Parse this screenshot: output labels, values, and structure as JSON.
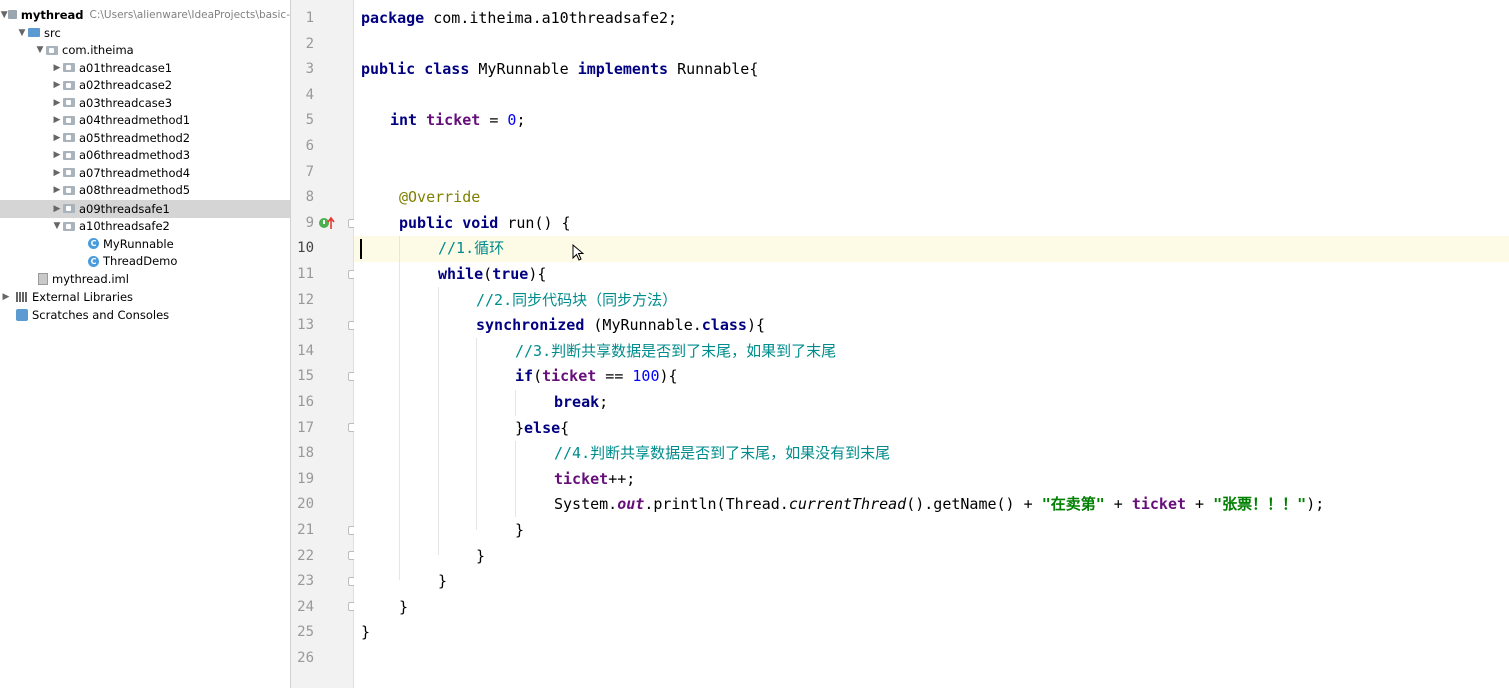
{
  "project": {
    "root_name": "mythread",
    "root_path": "C:\\Users\\alienware\\IdeaProjects\\basic-",
    "src": "src",
    "package": "com.itheima",
    "packages": [
      "a01threadcase1",
      "a02threadcase2",
      "a03threadcase3",
      "a04threadmethod1",
      "a05threadmethod2",
      "a06threadmethod3",
      "a07threadmethod4",
      "a08threadmethod5",
      "a09threadsafe1",
      "a10threadsafe2"
    ],
    "classes": [
      "MyRunnable",
      "ThreadDemo"
    ],
    "iml": "mythread.iml",
    "external_libraries": "External Libraries",
    "scratches": "Scratches and Consoles"
  },
  "editor": {
    "line_numbers": [
      "1",
      "2",
      "3",
      "4",
      "5",
      "6",
      "7",
      "8",
      "9",
      "10",
      "11",
      "12",
      "13",
      "14",
      "15",
      "16",
      "17",
      "18",
      "19",
      "20",
      "21",
      "22",
      "23",
      "24",
      "25",
      "26"
    ],
    "current_line": 10,
    "code": {
      "l1_kw": "package",
      "l1_rest": " com.itheima.a10threadsafe2;",
      "l3_kw1": "public",
      "l3_kw2": "class",
      "l3_name": " MyRunnable ",
      "l3_kw3": "implements",
      "l3_rest": " Runnable{",
      "l5_kw": "int",
      "l5_field": "ticket",
      "l5_eq": " = ",
      "l5_num": "0",
      "l5_end": ";",
      "l8_ann": "@Override",
      "l9_kw1": "public",
      "l9_kw2": "void",
      "l9_rest": " run() {",
      "l10_cm": "//1.循环",
      "l11_kw1": "while",
      "l11_p1": "(",
      "l11_kw2": "true",
      "l11_p2": "){",
      "l12_cm": "//2.同步代码块（同步方法）",
      "l13_kw1": "synchronized",
      "l13_p1": " (MyRunnable.",
      "l13_kw2": "class",
      "l13_p2": "){",
      "l14_cm": "//3.判断共享数据是否到了末尾，如果到了末尾",
      "l15_kw": "if",
      "l15_p1": "(",
      "l15_field": "ticket",
      "l15_op": " == ",
      "l15_num": "100",
      "l15_p2": "){",
      "l16_kw": "break",
      "l16_end": ";",
      "l17_p1": "}",
      "l17_kw": "else",
      "l17_p2": "{",
      "l18_cm": "//4.判断共享数据是否到了末尾，如果没有到末尾",
      "l19_field": "ticket",
      "l19_rest": "++;",
      "l20_a": "System.",
      "l20_out": "out",
      "l20_b": ".println(Thread.",
      "l20_ct": "currentThread",
      "l20_c": "().getName() + ",
      "l20_s1": "\"在卖第\"",
      "l20_d": " + ",
      "l20_field": "ticket",
      "l20_e": " + ",
      "l20_s2": "\"张票！！！\"",
      "l20_f": ");",
      "l21": "}",
      "l22": "}",
      "l23": "}",
      "l24": "}",
      "l25": "}"
    }
  },
  "colors": {
    "keyword": "#000080",
    "field": "#660e7a",
    "comment": "#008c8c",
    "annotation": "#808000",
    "string": "#008000",
    "number": "#0000ff",
    "current_line_bg": "#fdfbe6",
    "selected_row_bg": "#d5d5d5"
  },
  "icons": [
    "chevron-down-icon",
    "chevron-right-icon",
    "folder-icon",
    "package-icon",
    "class-icon",
    "module-file-icon",
    "library-icon",
    "scratches-icon",
    "override-marker-icon",
    "fold-marker-icon"
  ]
}
